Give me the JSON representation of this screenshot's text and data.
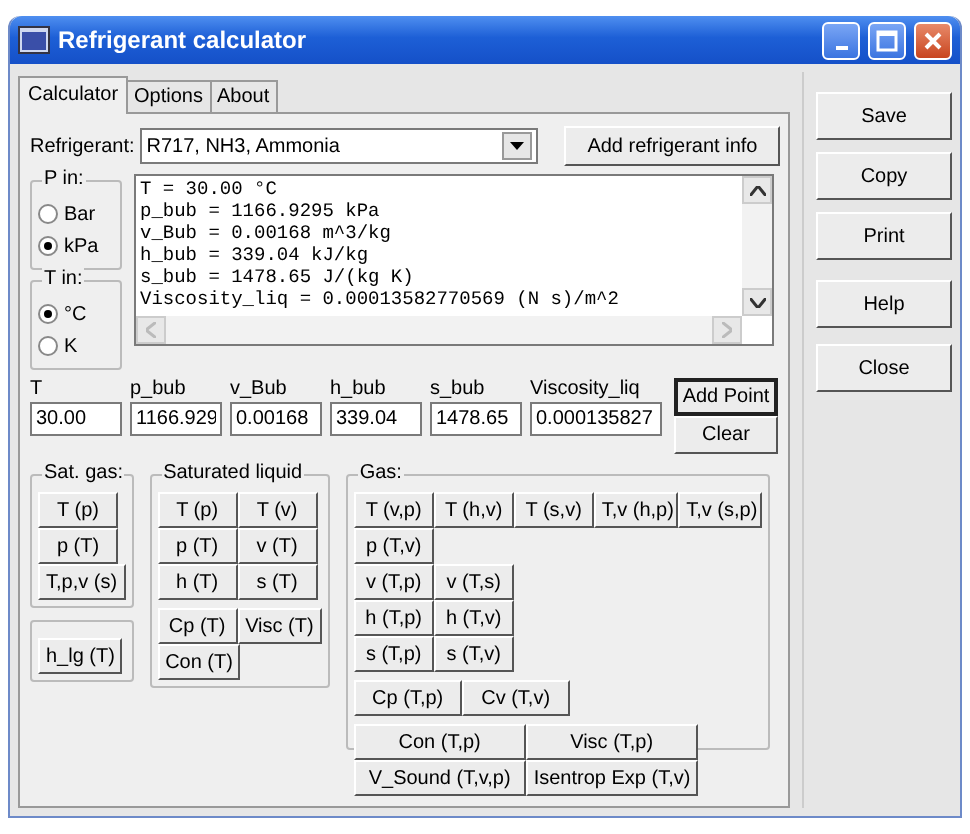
{
  "window": {
    "title": "Refrigerant calculator"
  },
  "tabs": [
    {
      "label": "Calculator",
      "selected": true
    },
    {
      "label": "Options",
      "selected": false
    },
    {
      "label": "About",
      "selected": false
    }
  ],
  "refrigerant": {
    "label": "Refrigerant:",
    "value": "R717, NH3, Ammonia"
  },
  "add_info_button": {
    "label": "Add refrigerant info"
  },
  "unit_groups": [
    {
      "title": "P in:",
      "options": [
        {
          "label": "Bar",
          "selected": false
        },
        {
          "label": "kPa",
          "selected": true
        }
      ]
    },
    {
      "title": "T in:",
      "options": [
        {
          "label": "°C",
          "selected": true
        },
        {
          "label": "K",
          "selected": false
        }
      ]
    }
  ],
  "output_lines": [
    "T = 30.00 °C",
    "p_bub = 1166.9295 kPa",
    "v_Bub = 0.00168 m^3/kg",
    "h_bub = 339.04 kJ/kg",
    "s_bub = 1478.65 J/(kg K)",
    "Viscosity_liq = 0.00013582770569 (N s)/m^2"
  ],
  "fields": [
    {
      "label": "T",
      "value": "30.00"
    },
    {
      "label": "p_bub",
      "value": "1166.929"
    },
    {
      "label": "v_Bub",
      "value": "0.00168"
    },
    {
      "label": "h_bub",
      "value": "339.04"
    },
    {
      "label": "s_bub",
      "value": "1478.65"
    },
    {
      "label": "Viscosity_liq",
      "value": "0.000135827"
    }
  ],
  "point_buttons": [
    {
      "label": "Add Point",
      "default": true
    },
    {
      "label": "Clear",
      "default": false
    }
  ],
  "groups": [
    {
      "title": "Sat. gas:",
      "blocks": [
        {
          "kind": "normal",
          "rows": [
            [
              "T (p)"
            ],
            [
              "p (T)"
            ],
            [
              "T,p,v (s)"
            ]
          ]
        }
      ]
    },
    {
      "blocks": [
        {
          "kind": "normal",
          "rows": [
            [
              "h_lg (T)"
            ]
          ]
        }
      ]
    },
    {
      "title": "Saturated liquid",
      "blocks": [
        {
          "kind": "normal",
          "rows": [
            [
              "T (p)",
              "T (v)"
            ],
            [
              "p (T)",
              "v (T)"
            ],
            [
              "h (T)",
              "s (T)"
            ]
          ]
        },
        {
          "kind": "normal",
          "rows": [
            [
              "Cp (T)",
              "Visc (T)"
            ],
            [
              "Con (T)"
            ]
          ]
        }
      ]
    },
    {
      "title": "Gas:",
      "blocks": [
        {
          "kind": "normal",
          "rows": [
            [
              "T (v,p)",
              "T (h,v)",
              "T (s,v)",
              "T,v (h,p)",
              "T,v (s,p)"
            ],
            [
              "p (T,v)"
            ],
            [
              "v (T,p)",
              "v (T,s)"
            ],
            [
              "h (T,p)",
              "h (T,v)"
            ],
            [
              "s (T,p)",
              "s (T,v)"
            ]
          ]
        },
        {
          "kind": "medium",
          "rows": [
            [
              "Cp (T,p)",
              "Cv (T,v)"
            ]
          ]
        },
        {
          "kind": "wide",
          "rows": [
            [
              "Con (T,p)",
              "Visc (T,p)"
            ],
            [
              "V_Sound (T,v,p)",
              "Isentrop Exp (T,v)"
            ]
          ]
        }
      ]
    }
  ],
  "side_buttons": [
    {
      "label": "Save"
    },
    {
      "label": "Copy"
    },
    {
      "label": "Print"
    },
    {
      "label": "Help"
    },
    {
      "label": "Close"
    }
  ]
}
